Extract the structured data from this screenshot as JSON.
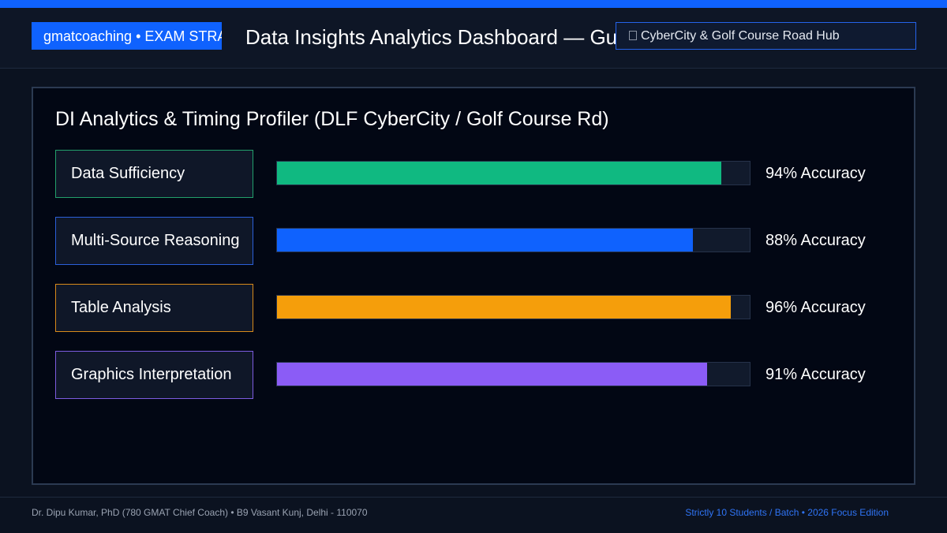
{
  "header": {
    "brand_badge": "gmatcoaching • EXAM STRATEGY",
    "title": "Data Insights Analytics Dashboard — Gurugram",
    "location_icon": "square-glyph-icon",
    "location": "CyberCity & Golf Course Road Hub"
  },
  "panel": {
    "title": "DI Analytics & Timing Profiler (DLF CyberCity / Golf Course Rd)",
    "metrics": [
      {
        "label": "Data Sufficiency",
        "accuracy": 94,
        "value_text": "94% Accuracy",
        "color": "#10b981"
      },
      {
        "label": "Multi-Source Reasoning",
        "accuracy": 88,
        "value_text": "88% Accuracy",
        "color": "#0f62fe"
      },
      {
        "label": "Table Analysis",
        "accuracy": 96,
        "value_text": "96% Accuracy",
        "color": "#f59e0b"
      },
      {
        "label": "Graphics Interpretation",
        "accuracy": 91,
        "value_text": "91% Accuracy",
        "color": "#8b5cf6"
      }
    ]
  },
  "footer": {
    "left": "Dr. Dipu Kumar, PhD (780 GMAT Chief Coach) • B9 Vasant Kunj, Delhi - 110070",
    "right": "Strictly 10 Students / Batch • 2026 Focus Edition"
  },
  "colors": {
    "accent": "#0f62fe",
    "background": "#0b1220",
    "panel_background": "#020714"
  }
}
